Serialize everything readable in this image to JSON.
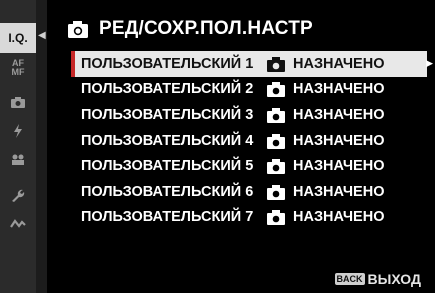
{
  "header": {
    "title": "РЕД/СОХР.ПОЛ.НАСТР",
    "icon": "camera-icon"
  },
  "sidebar": {
    "items": [
      {
        "label": "I.Q.",
        "icon": "image-quality-icon",
        "active": true
      },
      {
        "label": "AF MF",
        "icon": "af-mf-icon",
        "active": false
      },
      {
        "label": "",
        "icon": "camera-icon",
        "active": false
      },
      {
        "label": "",
        "icon": "flash-icon",
        "active": false
      },
      {
        "label": "",
        "icon": "movie-icon",
        "active": false
      },
      {
        "label": "",
        "icon": "wrench-icon",
        "active": false
      },
      {
        "label": "",
        "icon": "connection-icon",
        "active": false
      }
    ]
  },
  "menu": {
    "rows": [
      {
        "name": "ПОЛЬЗОВАТЕЛЬСКИЙ 1",
        "value": "НАЗНАЧЕНО"
      },
      {
        "name": "ПОЛЬЗОВАТЕЛЬСКИЙ 2",
        "value": "НАЗНАЧЕНО"
      },
      {
        "name": "ПОЛЬЗОВАТЕЛЬСКИЙ 3",
        "value": "НАЗНАЧЕНО"
      },
      {
        "name": "ПОЛЬЗОВАТЕЛЬСКИЙ 4",
        "value": "НАЗНАЧЕНО"
      },
      {
        "name": "ПОЛЬЗОВАТЕЛЬСКИЙ 5",
        "value": "НАЗНАЧЕНО"
      },
      {
        "name": "ПОЛЬЗОВАТЕЛЬСКИЙ 6",
        "value": "НАЗНАЧЕНО"
      },
      {
        "name": "ПОЛЬЗОВАТЕЛЬСКИЙ 7",
        "value": "НАЗНАЧЕНО"
      }
    ],
    "selected_index": 0
  },
  "footer": {
    "back_button": "BACK",
    "label": "ВЫХОД"
  },
  "colors": {
    "accent": "#c62828",
    "selected_bg": "#e8e8e8"
  }
}
